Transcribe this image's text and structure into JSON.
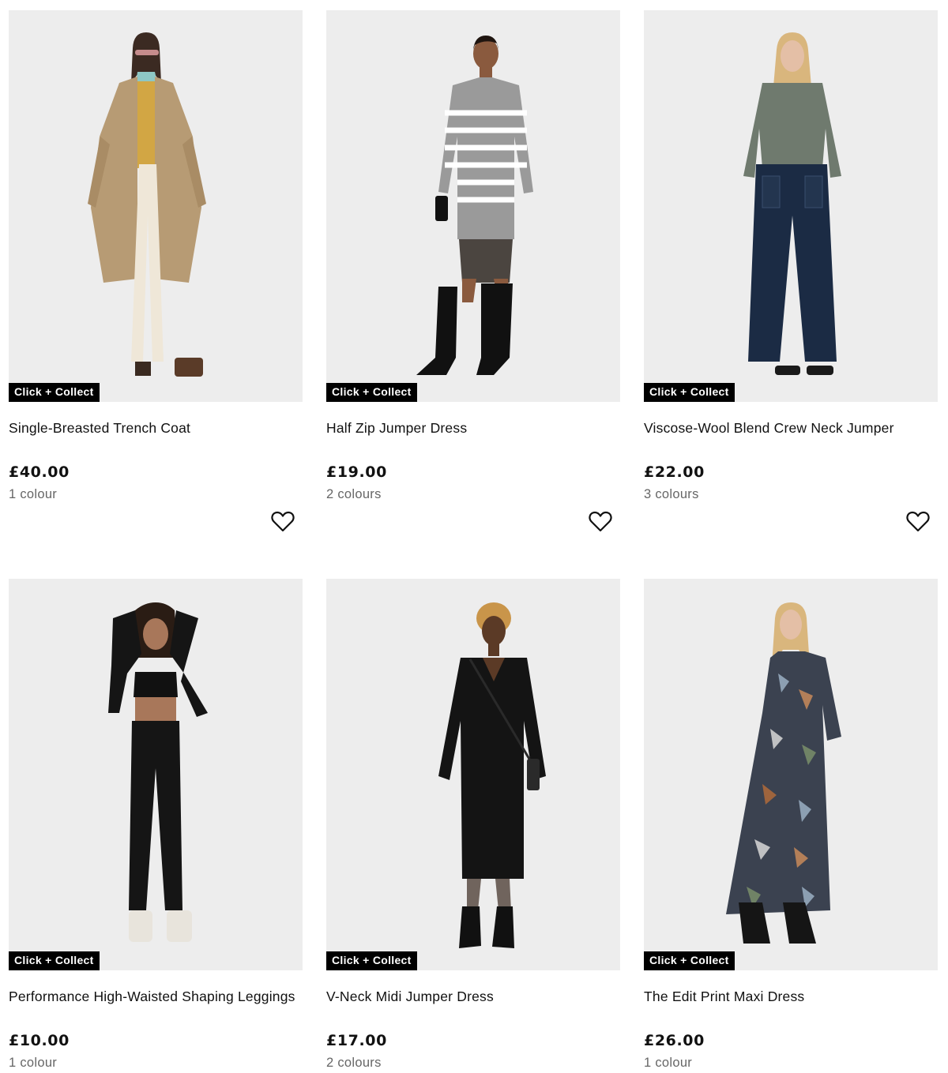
{
  "products": [
    {
      "title": "Single-Breasted Trench Coat",
      "price": "£40.00",
      "colours": "1 colour",
      "badge": "Click + Collect",
      "icon": "heart-outline-icon"
    },
    {
      "title": "Half Zip Jumper Dress",
      "price": "£19.00",
      "colours": "2 colours",
      "badge": "Click + Collect",
      "icon": "heart-outline-icon"
    },
    {
      "title": "Viscose-Wool Blend Crew Neck Jumper",
      "price": "£22.00",
      "colours": "3 colours",
      "badge": "Click + Collect",
      "icon": "heart-outline-icon"
    },
    {
      "title": "Performance High-Waisted Shaping Leggings",
      "price": "£10.00",
      "colours": "1 colour",
      "badge": "Click + Collect",
      "icon": "heart-outline-icon"
    },
    {
      "title": "V-Neck Midi Jumper Dress",
      "price": "£17.00",
      "colours": "2 colours",
      "badge": "Click + Collect",
      "icon": "heart-outline-icon"
    },
    {
      "title": "The Edit Print Maxi Dress",
      "price": "£26.00",
      "colours": "1 colour",
      "badge": "Click + Collect",
      "icon": "heart-outline-icon"
    }
  ],
  "colors": {
    "image_background": "#ededed",
    "badge_background": "#000000",
    "badge_text": "#ffffff",
    "price_text": "#111111",
    "colours_text": "#666666"
  }
}
